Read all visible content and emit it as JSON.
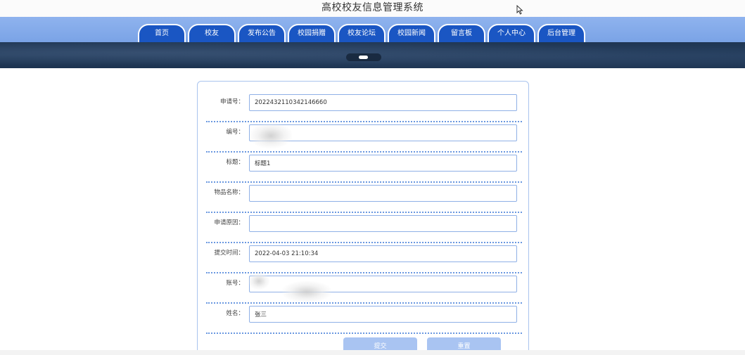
{
  "header": {
    "title": "高校校友信息管理系统"
  },
  "nav": {
    "tabs": [
      {
        "label": "首页"
      },
      {
        "label": "校友"
      },
      {
        "label": "发布公告"
      },
      {
        "label": "校园捐赠"
      },
      {
        "label": "校友论坛"
      },
      {
        "label": "校园新闻"
      },
      {
        "label": "留言板"
      },
      {
        "label": "个人中心"
      },
      {
        "label": "后台管理"
      }
    ]
  },
  "form": {
    "fields": [
      {
        "label": "申请号：",
        "value": "2022432110342146660"
      },
      {
        "label": "编号：",
        "value": ""
      },
      {
        "label": "标题：",
        "value": "标题1"
      },
      {
        "label": "物品名称：",
        "value": ""
      },
      {
        "label": "申请原因：",
        "value": ""
      },
      {
        "label": "提交时间：",
        "value": "2022-04-03 21:10:34"
      },
      {
        "label": "账号：",
        "value": ""
      },
      {
        "label": "姓名：",
        "value": "张三"
      }
    ],
    "submit_label": "提交",
    "reset_label": "重置"
  },
  "colors": {
    "nav_band": "#8fb3ee",
    "nav_tab": "#1a56c3",
    "banner": "#243d5c",
    "input_border": "#8fb0e6",
    "divider": "#6a98e0",
    "button": "#a9c4f2"
  }
}
